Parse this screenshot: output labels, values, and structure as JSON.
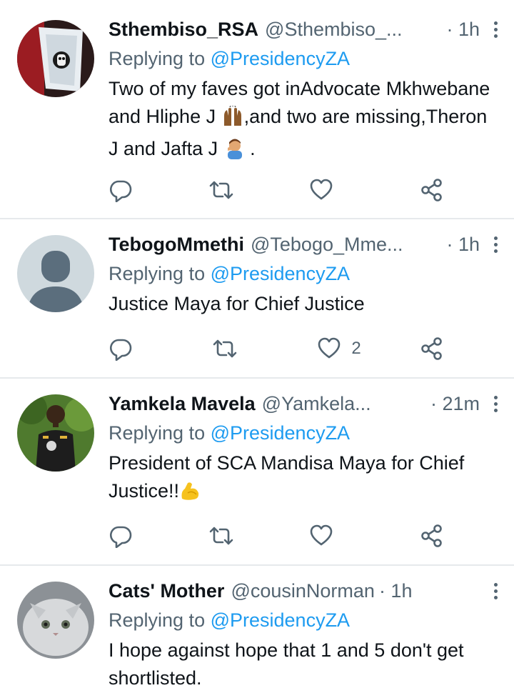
{
  "tweets": [
    {
      "display_name": "Sthembiso_RSA",
      "handle": "@Sthembiso_...",
      "time": "· 1h",
      "replying_prefix": "Replying to ",
      "replying_to": "@PresidencyZA",
      "text_parts": [
        "Two of my faves got inAdvocate Mkhwebane and Hliphe J ",
        ",and two are missing,Theron J and Jafta J ",
        " ."
      ],
      "emojis": [
        "raising-hands-emoji",
        "facepalm-emoji"
      ],
      "like_count": ""
    },
    {
      "display_name": "TebogoMmethi",
      "handle": "@Tebogo_Mme...",
      "time": "· 1h",
      "replying_prefix": "Replying to ",
      "replying_to": "@PresidencyZA",
      "text": "Justice Maya for Chief Justice",
      "like_count": "2"
    },
    {
      "display_name": "Yamkela Mavela",
      "handle": "@Yamkela...",
      "time": "· 21m",
      "replying_prefix": "Replying to ",
      "replying_to": "@PresidencyZA",
      "text_parts": [
        "President of SCA Mandisa Maya for Chief Justice!!"
      ],
      "emojis": [
        "flexed-biceps-emoji"
      ],
      "like_count": ""
    },
    {
      "display_name": "Cats' Mother",
      "handle": "@cousinNorman",
      "time": "· 1h",
      "replying_prefix": "Replying to ",
      "replying_to": "@PresidencyZA",
      "text": "I hope against hope that 1 and 5 don't get shortlisted."
    }
  ],
  "colors": {
    "link": "#1d9bf0",
    "secondary_text": "#536471",
    "primary_text": "#0f1419",
    "divider": "#e6e9ec"
  },
  "icons": [
    "reply-icon",
    "retweet-icon",
    "like-icon",
    "share-icon",
    "more-icon"
  ]
}
